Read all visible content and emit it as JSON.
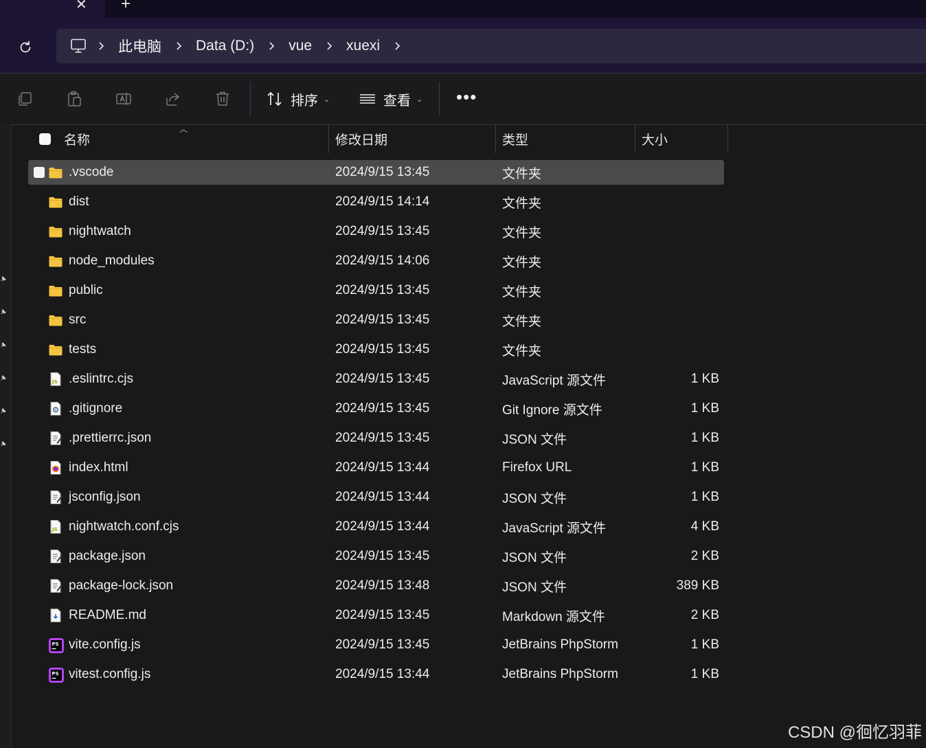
{
  "tabs": {
    "close_glyph": "✕",
    "new_tab_glyph": "+"
  },
  "breadcrumb": {
    "items": [
      "此电脑",
      "Data (D:)",
      "vue",
      "xuexi"
    ]
  },
  "toolbar": {
    "sort_label": "排序",
    "view_label": "查看",
    "more_glyph": "•••"
  },
  "columns": {
    "name": "名称",
    "date": "修改日期",
    "type": "类型",
    "size": "大小"
  },
  "files": [
    {
      "name": ".vscode",
      "date": "2024/9/15 13:45",
      "type": "文件夹",
      "size": "",
      "icon": "folder-icon"
    },
    {
      "name": "dist",
      "date": "2024/9/15 14:14",
      "type": "文件夹",
      "size": "",
      "icon": "folder-icon"
    },
    {
      "name": "nightwatch",
      "date": "2024/9/15 13:45",
      "type": "文件夹",
      "size": "",
      "icon": "folder-icon"
    },
    {
      "name": "node_modules",
      "date": "2024/9/15 14:06",
      "type": "文件夹",
      "size": "",
      "icon": "folder-icon"
    },
    {
      "name": "public",
      "date": "2024/9/15 13:45",
      "type": "文件夹",
      "size": "",
      "icon": "folder-icon"
    },
    {
      "name": "src",
      "date": "2024/9/15 13:45",
      "type": "文件夹",
      "size": "",
      "icon": "folder-icon"
    },
    {
      "name": "tests",
      "date": "2024/9/15 13:45",
      "type": "文件夹",
      "size": "",
      "icon": "folder-icon"
    },
    {
      "name": ".eslintrc.cjs",
      "date": "2024/9/15 13:45",
      "type": "JavaScript 源文件",
      "size": "1 KB",
      "icon": "js-file-icon"
    },
    {
      "name": ".gitignore",
      "date": "2024/9/15 13:45",
      "type": "Git Ignore 源文件",
      "size": "1 KB",
      "icon": "config-file-icon"
    },
    {
      "name": ".prettierrc.json",
      "date": "2024/9/15 13:45",
      "type": "JSON 文件",
      "size": "1 KB",
      "icon": "json-file-icon"
    },
    {
      "name": "index.html",
      "date": "2024/9/15 13:44",
      "type": "Firefox URL",
      "size": "1 KB",
      "icon": "firefox-file-icon"
    },
    {
      "name": "jsconfig.json",
      "date": "2024/9/15 13:44",
      "type": "JSON 文件",
      "size": "1 KB",
      "icon": "json-file-icon"
    },
    {
      "name": "nightwatch.conf.cjs",
      "date": "2024/9/15 13:44",
      "type": "JavaScript 源文件",
      "size": "4 KB",
      "icon": "js-file-icon"
    },
    {
      "name": "package.json",
      "date": "2024/9/15 13:45",
      "type": "JSON 文件",
      "size": "2 KB",
      "icon": "json-file-icon"
    },
    {
      "name": "package-lock.json",
      "date": "2024/9/15 13:48",
      "type": "JSON 文件",
      "size": "389 KB",
      "icon": "json-file-icon"
    },
    {
      "name": "README.md",
      "date": "2024/9/15 13:45",
      "type": "Markdown 源文件",
      "size": "2 KB",
      "icon": "markdown-file-icon"
    },
    {
      "name": "vite.config.js",
      "date": "2024/9/15 13:45",
      "type": "JetBrains PhpStorm",
      "size": "1 KB",
      "icon": "phpstorm-file-icon"
    },
    {
      "name": "vitest.config.js",
      "date": "2024/9/15 13:44",
      "type": "JetBrains PhpStorm",
      "size": "1 KB",
      "icon": "phpstorm-file-icon"
    }
  ],
  "watermark": "CSDN @徊忆羽菲",
  "colors": {
    "folder": "#f4c340",
    "selection": "#4a4a4c",
    "titlebar": "#1d1533",
    "address_bg": "#2b2840"
  }
}
